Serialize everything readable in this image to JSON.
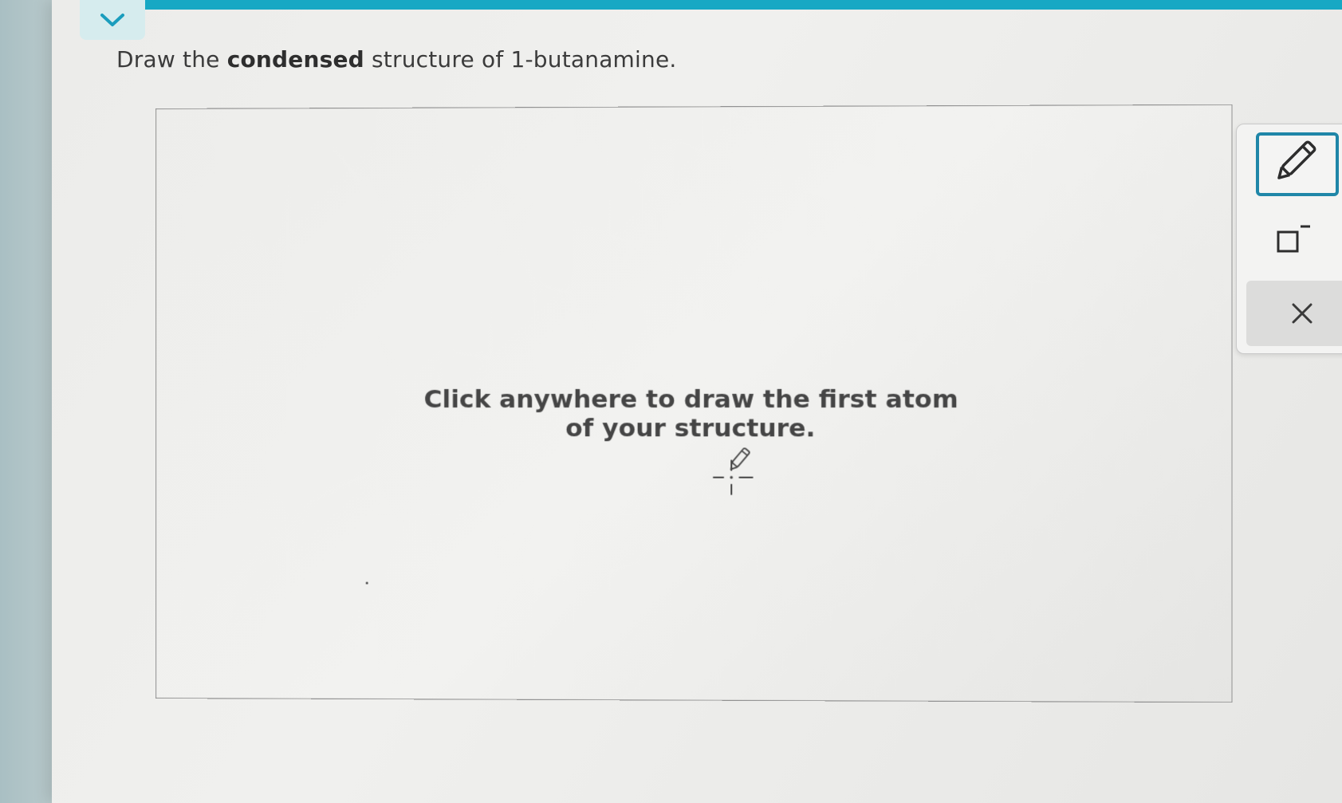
{
  "question": {
    "prefix": "Draw the ",
    "emphasis": "condensed",
    "suffix": " structure of 1-butanamine."
  },
  "canvas": {
    "hint_line1": "Click anywhere to draw the first atom",
    "hint_line2": "of your structure."
  },
  "toolbar": {
    "pencil_icon": "pencil-icon",
    "charge_icon": "charge-box-icon",
    "clear_icon": "close-icon",
    "active_color": "#1f86a8"
  },
  "colors": {
    "accent_bar": "#17a8c4",
    "collapse_tab": "#d6ecee"
  }
}
